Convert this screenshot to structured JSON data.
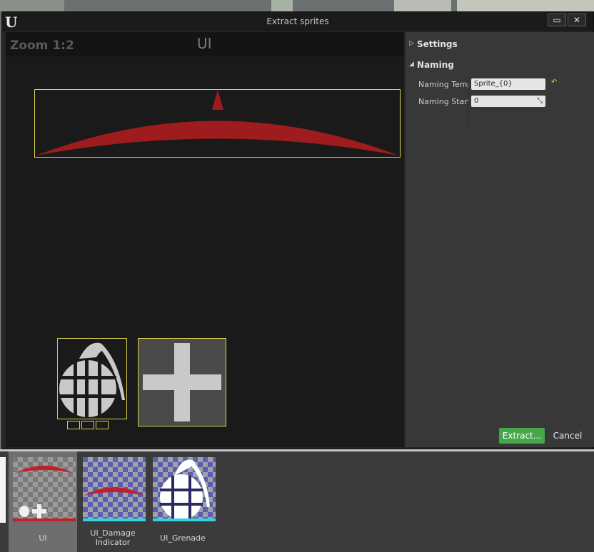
{
  "window": {
    "title": "Extract sprites",
    "logo_text": "U",
    "maximize_label": "▭",
    "close_label": "✕"
  },
  "viewport": {
    "zoom_label": "Zoom 1:2",
    "texture_name": "UI"
  },
  "details": {
    "settings_label": "Settings",
    "naming_label": "Naming",
    "naming_template_label": "Naming Temp",
    "naming_template_value": "Sprite_{0}",
    "naming_start_label": "Naming Start",
    "naming_start_value": "0"
  },
  "footer": {
    "extract_label": "Extract...",
    "cancel_label": "Cancel"
  },
  "assets": {
    "items": [
      {
        "label": "UI"
      },
      {
        "label_line1": "UI_Damage",
        "label_line2": "Indicator"
      },
      {
        "label": "UI_Grenade"
      }
    ]
  },
  "colors": {
    "accent_green": "#44a84a",
    "selection_yellow": "#d6d24a",
    "sprite_red": "#9e1b1e"
  }
}
